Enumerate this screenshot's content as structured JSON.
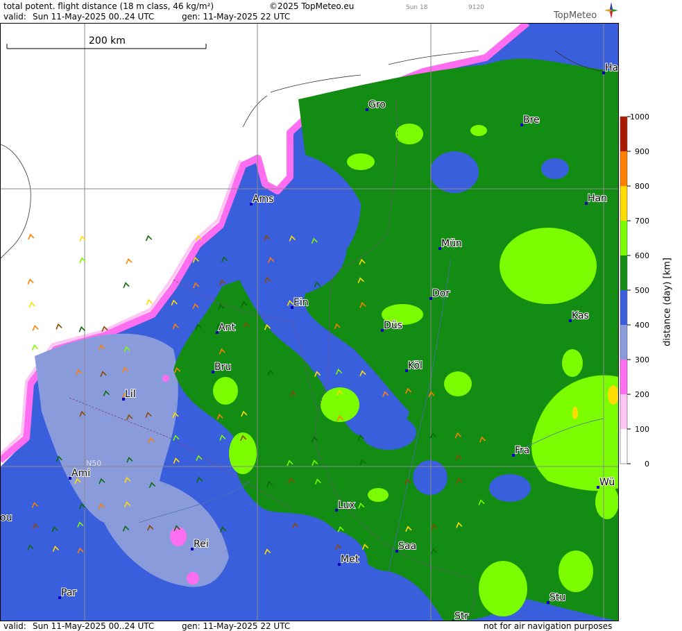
{
  "header": {
    "title": "total potent. flight distance (18 m class, 46 kg/m²)",
    "copyright": "©2025 TopMeteo.eu",
    "day_tag": "Sun 18",
    "code_tag": "9120",
    "valid_label": "valid:",
    "valid_value": "Sun  11-May-2025  00..24 UTC",
    "gen_value": "gen: 11-May-2025 22 UTC",
    "logo_text": "TopMeteo"
  },
  "footer": {
    "valid_label": "valid:",
    "valid_value": "Sun  11-May-2025  00..24 UTC",
    "gen_value": "gen: 11-May-2025 22 UTC",
    "disclaimer": "not for air navigation purposes"
  },
  "scale_bar": {
    "label": "200 km"
  },
  "grid_label": "N50",
  "cities": [
    {
      "name": "Ha"
    },
    {
      "name": "Gro"
    },
    {
      "name": "Bre"
    },
    {
      "name": "Ams"
    },
    {
      "name": "Han"
    },
    {
      "name": "Mün"
    },
    {
      "name": "Ein"
    },
    {
      "name": "Dor"
    },
    {
      "name": "Ant"
    },
    {
      "name": "Kas"
    },
    {
      "name": "Düs"
    },
    {
      "name": "Bru"
    },
    {
      "name": "Köl"
    },
    {
      "name": "Lil"
    },
    {
      "name": "Fra"
    },
    {
      "name": "Ami"
    },
    {
      "name": "Wü"
    },
    {
      "name": "Lux"
    },
    {
      "name": "ou"
    },
    {
      "name": "Rei"
    },
    {
      "name": "Saa"
    },
    {
      "name": "Met"
    },
    {
      "name": "Par"
    },
    {
      "name": "Stu"
    },
    {
      "name": "Str"
    }
  ],
  "legend": {
    "title": "distance (day) [km]",
    "ticks": [
      "1000",
      "900",
      "800",
      "700",
      "600",
      "500",
      "400",
      "300",
      "200",
      "100",
      "0"
    ],
    "colors": [
      "#aa1a00",
      "#ff7f00",
      "#ffdd00",
      "#7cfc00",
      "#128c12",
      "#3a5fdd",
      "#8a9bdc",
      "#ff6ef0",
      "#ffc6f5",
      "#ffffff"
    ]
  },
  "map_colors": {
    "blue": "#3a5fdd",
    "light_blue": "#8a9bdc",
    "dark_green": "#128c12",
    "light_green": "#7cfc00",
    "pink": "#ff6ef0",
    "yellow": "#ffdd00"
  }
}
